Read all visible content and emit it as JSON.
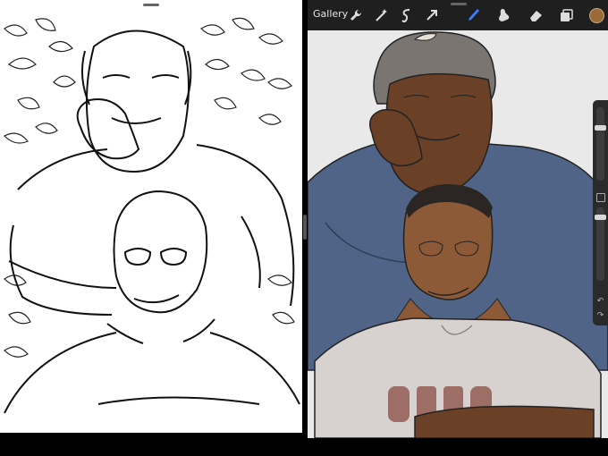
{
  "toolbar": {
    "gallery_label": "Gallery",
    "tools": [
      {
        "name": "wrench-icon"
      },
      {
        "name": "magic-wand-icon"
      },
      {
        "name": "selection-icon"
      },
      {
        "name": "transform-arrow-icon"
      },
      {
        "name": "brush-icon",
        "active": true
      },
      {
        "name": "smudge-icon"
      },
      {
        "name": "eraser-icon"
      },
      {
        "name": "layers-icon"
      }
    ],
    "current_color": "#9a6a3a",
    "accent_color": "#3d7fff"
  },
  "side_panel": {
    "undo_glyph": "↶",
    "redo_glyph": "↷"
  },
  "colors": {
    "canvas_right": "#e9e9ea",
    "shirt_blue": "#4f6487",
    "skin": "#6a4026",
    "skin_light": "#8c5a37",
    "white_shirt": "#d7d2d0",
    "letters": "#9c6e66"
  }
}
